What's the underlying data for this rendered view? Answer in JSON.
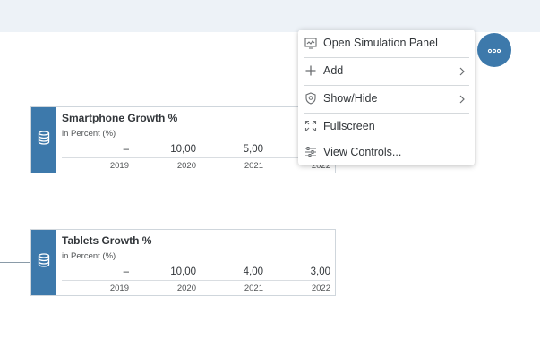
{
  "cards": [
    {
      "title": "Smartphone Growth %",
      "subtitle": "in Percent (%)",
      "values": [
        "–",
        "10,00",
        "5,00",
        ""
      ],
      "years": [
        "2019",
        "2020",
        "2021",
        "2022"
      ],
      "icon": "database-icon"
    },
    {
      "title": "Tablets Growth %",
      "subtitle": "in Percent (%)",
      "values": [
        "–",
        "10,00",
        "4,00",
        "3,00"
      ],
      "years": [
        "2019",
        "2020",
        "2021",
        "2022"
      ],
      "icon": "database-icon"
    }
  ],
  "context_menu": {
    "items": [
      {
        "label": "Open Simulation Panel",
        "icon": "simulation-panel-icon"
      },
      {
        "label": "Add",
        "icon": "plus-icon",
        "has_submenu": true
      },
      {
        "label": "Show/Hide",
        "icon": "shield-icon",
        "has_submenu": true
      },
      {
        "label": "Fullscreen",
        "icon": "fullscreen-icon"
      },
      {
        "label": "View Controls...",
        "icon": "view-controls-icon"
      }
    ]
  },
  "more_button": {
    "icon": "more-icon"
  },
  "colors": {
    "accent": "#3d79ab",
    "topbar": "#edf2f7"
  }
}
